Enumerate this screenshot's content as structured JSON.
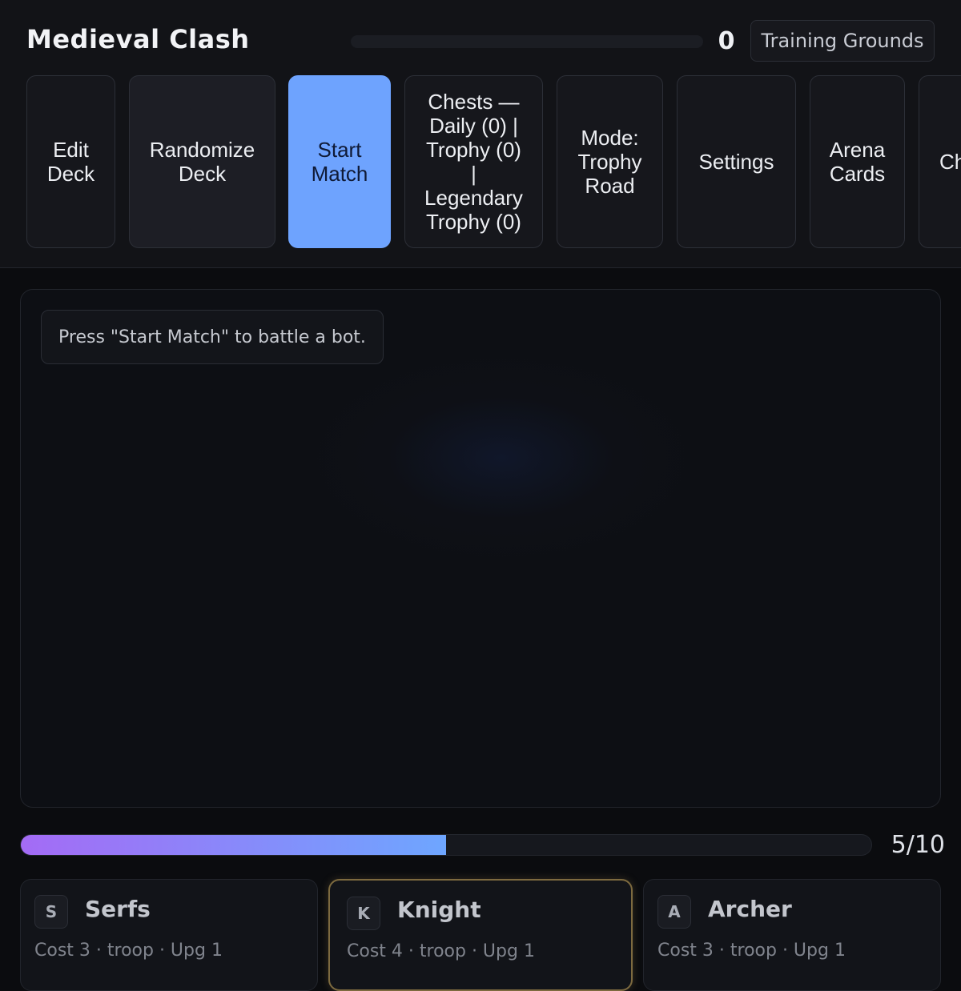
{
  "app": {
    "title": "Medieval Clash",
    "trophies": "0",
    "trophy_progress": 0,
    "arena_name": "Training Grounds"
  },
  "nav": {
    "edit_deck": "Edit\nDeck",
    "randomize_deck": "Randomize\nDeck",
    "start_match": "Start\nMatch",
    "chests": "Chests —\nDaily (0) |\nTrophy (0)\n|\nLegendary\nTrophy (0)",
    "mode": "Mode:\nTrophy\nRoad",
    "settings": "Settings",
    "arena_cards": "Arena\nCards",
    "partial": "Ch"
  },
  "arena": {
    "status": "Press \"Start Match\" to battle a bot."
  },
  "elixir": {
    "current": 5,
    "max": 10,
    "label": "5/10"
  },
  "hand": [
    {
      "letter": "S",
      "name": "Serfs",
      "meta": "Cost 3 · troop · Upg 1"
    },
    {
      "letter": "K",
      "name": "Knight",
      "meta": "Cost 4 · troop · Upg 1"
    },
    {
      "letter": "A",
      "name": "Archer",
      "meta": "Cost 3 · troop · Upg 1"
    }
  ],
  "colors": {
    "primary": "#6ea3fe",
    "elixir_start": "#a46bf5",
    "elixir_end": "#6ea6ff",
    "selected_border": "#7d6a3f"
  },
  "icons": {
    "card_badge": "letter-badge-icon"
  }
}
